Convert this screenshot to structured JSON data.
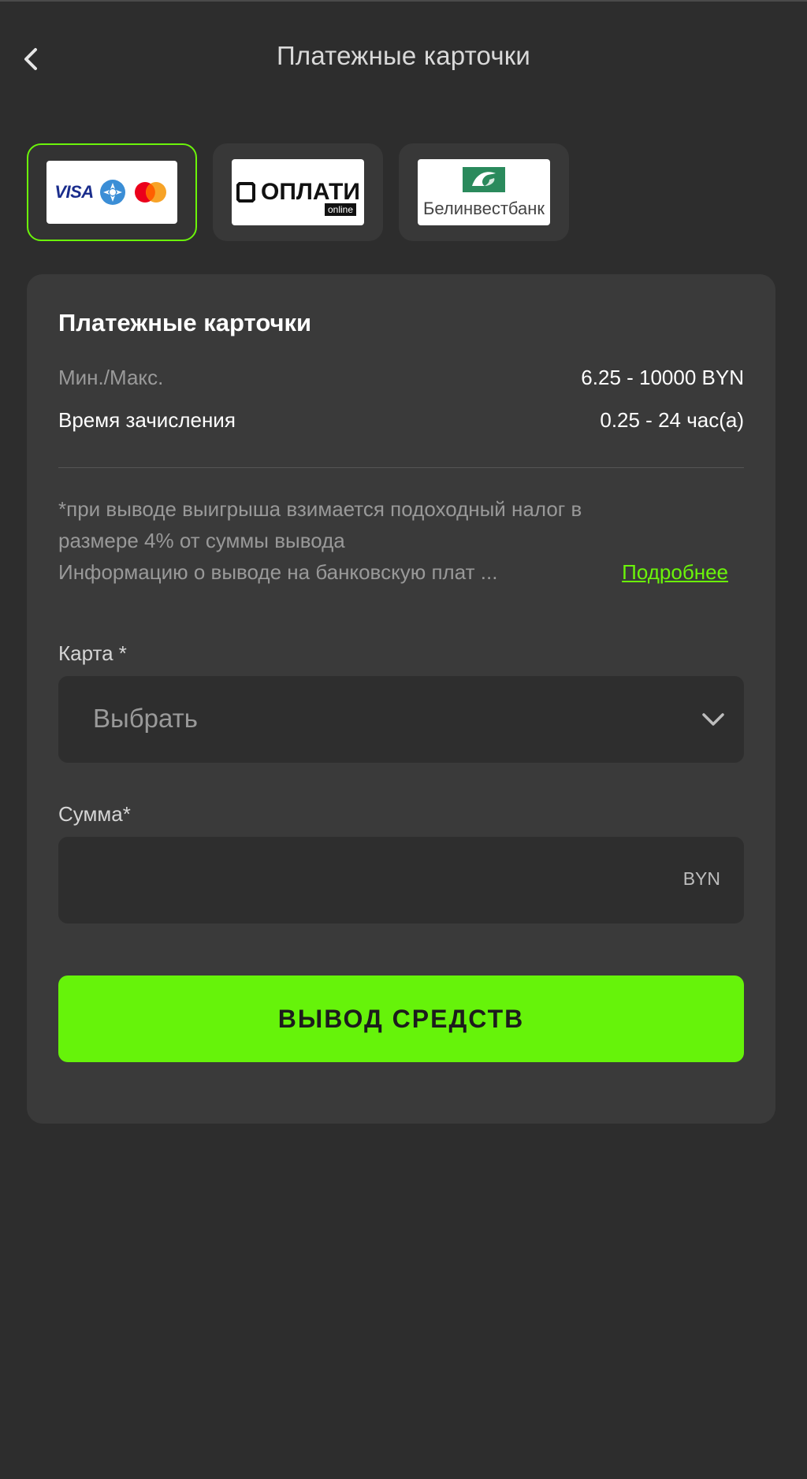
{
  "header": {
    "title": "Платежные карточки"
  },
  "methods": [
    {
      "name": "cards",
      "logo_text": "VISA",
      "active": true
    },
    {
      "name": "oplati",
      "logo_text": "ОПЛАТИ",
      "logo_sub": "online",
      "active": false
    },
    {
      "name": "belinvestbank",
      "logo_text": "Белинвестбанк",
      "active": false
    }
  ],
  "panel": {
    "title": "Платежные карточки",
    "min_max_label": "Мин./Макс.",
    "min_max_value": "6.25 - 10000 BYN",
    "time_label": "Время зачисления",
    "time_value": "0.25 - 24 час(а)",
    "note_line1": "*при выводе выигрыша взимается подоходный налог в",
    "note_line2": "размере 4% от суммы вывода",
    "note_line3": "Информацию о выводе на банковскую плат ...",
    "more_link": "Подробнее"
  },
  "form": {
    "card_label": "Карта *",
    "card_placeholder": "Выбрать",
    "amount_label": "Сумма*",
    "amount_value": "",
    "amount_currency": "BYN",
    "submit_label": "ВЫВОД СРЕДСТВ"
  },
  "colors": {
    "background": "#2d2d2d",
    "panel": "#3a3a3a",
    "accent": "#66f30a",
    "input_bg": "#2e2e2e"
  }
}
